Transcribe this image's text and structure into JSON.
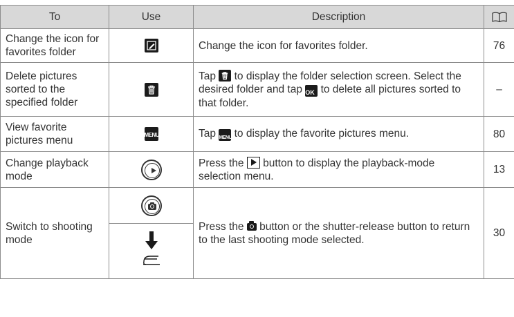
{
  "header": {
    "to": "To",
    "use": "Use",
    "description": "Description",
    "reference_icon": "book-icon"
  },
  "rows": [
    {
      "to": "Change the icon for favorites folder",
      "use_icon": "edit-icon",
      "description": "Change the icon for favorites folder.",
      "page": "76"
    },
    {
      "to": "Delete pictures sorted to the specified folder",
      "use_icon": "trash-icon",
      "description_parts": [
        "Tap",
        "to display the folder selection screen. Select the desired folder and tap",
        "to delete all pictures sorted to that folder."
      ],
      "page": "–"
    },
    {
      "to": "View favorite pictures menu",
      "use_icon": "menu-icon",
      "menu_label": "MENU",
      "description_parts": [
        "Tap",
        "to display the favorite pictures menu."
      ],
      "page": "80"
    },
    {
      "to": "Change playback mode",
      "use_icon": "playback-button-icon",
      "description_parts": [
        "Press the",
        "button to display the playback-mode selection menu."
      ],
      "page": "13"
    },
    {
      "to": "Switch to shooting mode",
      "use_icons": [
        "shooting-button-icon",
        "shutter-release-icon"
      ],
      "description_parts": [
        "Press the",
        "button or the shutter-release button to return to the last shooting mode selected."
      ],
      "page": "30"
    }
  ],
  "ok_label": "OK"
}
